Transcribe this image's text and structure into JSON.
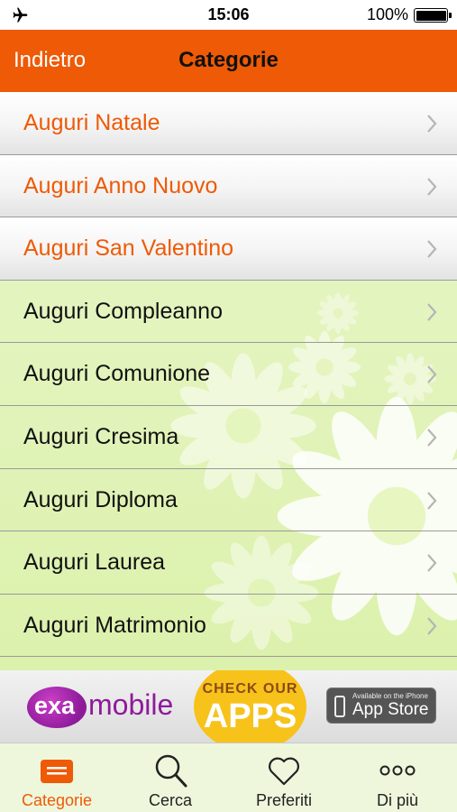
{
  "status_bar": {
    "time": "15:06",
    "battery": "100%"
  },
  "nav": {
    "back_label": "Indietro",
    "title": "Categorie"
  },
  "list": {
    "items": [
      {
        "label": "Auguri Natale",
        "highlighted": true
      },
      {
        "label": "Auguri Anno Nuovo",
        "highlighted": true
      },
      {
        "label": "Auguri San Valentino",
        "highlighted": true
      },
      {
        "label": "Auguri Compleanno",
        "highlighted": false
      },
      {
        "label": "Auguri Comunione",
        "highlighted": false
      },
      {
        "label": "Auguri Cresima",
        "highlighted": false
      },
      {
        "label": "Auguri Diploma",
        "highlighted": false
      },
      {
        "label": "Auguri Laurea",
        "highlighted": false
      },
      {
        "label": "Auguri Matrimonio",
        "highlighted": false
      }
    ]
  },
  "ad": {
    "brand_exa": "exa",
    "brand_mobile": "mobile",
    "check_our": "CHECK OUR",
    "apps": "APPS",
    "appstore_small": "Available on the iPhone",
    "appstore_big": "App Store"
  },
  "tabs": [
    {
      "label": "Categorie",
      "icon": "list-icon",
      "active": true
    },
    {
      "label": "Cerca",
      "icon": "search-icon",
      "active": false
    },
    {
      "label": "Preferiti",
      "icon": "heart-icon",
      "active": false
    },
    {
      "label": "Di più",
      "icon": "more-icon",
      "active": false
    }
  ],
  "colors": {
    "accent": "#ee5a05",
    "background": "#dcf1ac",
    "ad_purple": "#8e1a9a",
    "ad_yellow": "#f7c21a"
  }
}
